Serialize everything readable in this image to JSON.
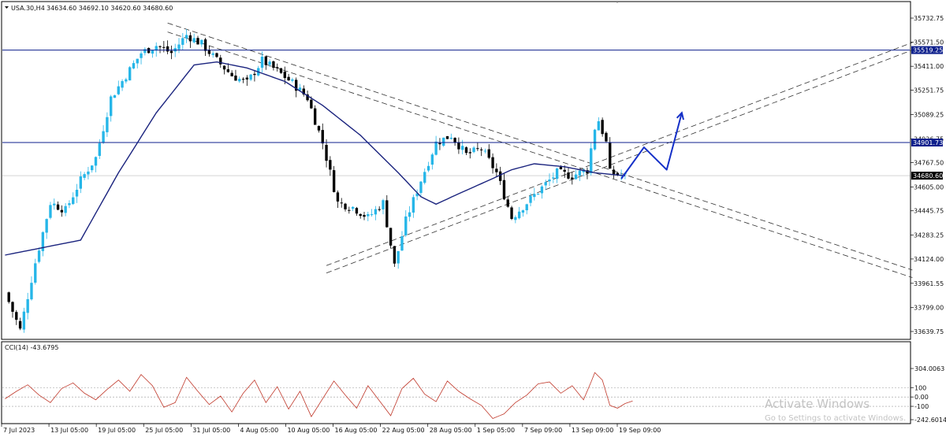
{
  "header": {
    "symbol": "USA.30,H4",
    "ohlc": "34634.60 34692.10 34620.60 34680.60"
  },
  "indicator": {
    "label": "CCI(14) -43.6795",
    "levels": [
      "304.0063",
      "100",
      "0.00",
      "-100",
      "-242.6014"
    ]
  },
  "watermark": {
    "title": "Activate Windows",
    "subtitle": "Go to Settings to activate Windows."
  },
  "colors": {
    "bull": "#26b6e8",
    "bear": "#000000",
    "ma": "#1a237e",
    "hline": "#0d1f8c",
    "cci": "#c0392b",
    "arrow": "#1530c8"
  },
  "chart_data": [
    {
      "type": "candlestick",
      "symbol": "USA.30",
      "timeframe": "H4",
      "y_ticks": [
        35732.75,
        35571.5,
        35411.0,
        35251.75,
        35089.25,
        34926.75,
        34767.5,
        34605.0,
        34445.75,
        34283.25,
        34124.0,
        33961.55,
        33799.0,
        33639.75
      ],
      "y_tick_labels": [
        "35732.75",
        "35571.50",
        "35411.00",
        "35251.75",
        "35089.25",
        "34926.75",
        "34767.50",
        "34605.00",
        "34445.75",
        "34283.25",
        "34124.00",
        "33961.55",
        "33799.00",
        "33639.75"
      ],
      "ylim": [
        33600,
        35800
      ],
      "x_tick_labels": [
        "7 Jul 2023",
        "13 Jul 05:00",
        "19 Jul 05:00",
        "25 Jul 05:00",
        "31 Jul 05:00",
        "4 Aug 05:00",
        "10 Aug 05:00",
        "16 Aug 05:00",
        "22 Aug 05:00",
        "28 Aug 05:00",
        "1 Sep 05:00",
        "7 Sep 09:00",
        "13 Sep 09:00",
        "19 Sep 09:00"
      ],
      "horizontal_levels": [
        {
          "value": 35519.25,
          "label": "35519.25"
        },
        {
          "value": 34901.73,
          "label": "34901.73"
        }
      ],
      "current_price": {
        "value": 34680.6,
        "label": "34680.60"
      },
      "close_path": [
        [
          0,
          33900
        ],
        [
          4,
          33650
        ],
        [
          8,
          34100
        ],
        [
          12,
          34500
        ],
        [
          16,
          34450
        ],
        [
          20,
          34650
        ],
        [
          24,
          34800
        ],
        [
          28,
          35200
        ],
        [
          32,
          35350
        ],
        [
          36,
          35500
        ],
        [
          40,
          35550
        ],
        [
          44,
          35500
        ],
        [
          48,
          35620
        ],
        [
          52,
          35560
        ],
        [
          56,
          35450
        ],
        [
          60,
          35350
        ],
        [
          64,
          35300
        ],
        [
          68,
          35450
        ],
        [
          72,
          35380
        ],
        [
          76,
          35300
        ],
        [
          80,
          35200
        ],
        [
          84,
          34900
        ],
        [
          88,
          34500
        ],
        [
          92,
          34470
        ],
        [
          96,
          34400
        ],
        [
          100,
          34500
        ],
        [
          103,
          34080
        ],
        [
          106,
          34380
        ],
        [
          110,
          34650
        ],
        [
          114,
          34900
        ],
        [
          118,
          34950
        ],
        [
          122,
          34820
        ],
        [
          126,
          34860
        ],
        [
          130,
          34700
        ],
        [
          134,
          34400
        ],
        [
          138,
          34500
        ],
        [
          142,
          34600
        ],
        [
          146,
          34700
        ],
        [
          150,
          34680
        ],
        [
          154,
          34720
        ],
        [
          156,
          35000
        ],
        [
          157,
          35050
        ],
        [
          159,
          34900
        ],
        [
          160,
          34700
        ],
        [
          164,
          34680
        ]
      ],
      "ma_path": [
        [
          0,
          34150
        ],
        [
          20,
          34250
        ],
        [
          30,
          34700
        ],
        [
          40,
          35100
        ],
        [
          50,
          35420
        ],
        [
          56,
          35440
        ],
        [
          64,
          35400
        ],
        [
          74,
          35310
        ],
        [
          84,
          35150
        ],
        [
          94,
          34950
        ],
        [
          104,
          34700
        ],
        [
          110,
          34540
        ],
        [
          114,
          34490
        ],
        [
          120,
          34560
        ],
        [
          128,
          34650
        ],
        [
          134,
          34720
        ],
        [
          140,
          34760
        ],
        [
          148,
          34740
        ],
        [
          156,
          34700
        ],
        [
          164,
          34680
        ]
      ],
      "x_domain": [
        0,
        240
      ]
    },
    {
      "type": "line",
      "name": "CCI(14)",
      "value": -43.6795,
      "y_ticks": [
        304.0063,
        100,
        0,
        -100,
        -242.6014
      ],
      "ylim": [
        -242.6014,
        304.0063
      ],
      "x_domain": [
        0,
        240
      ],
      "points": [
        [
          0,
          -20
        ],
        [
          3,
          60
        ],
        [
          6,
          130
        ],
        [
          9,
          20
        ],
        [
          12,
          -60
        ],
        [
          15,
          90
        ],
        [
          18,
          150
        ],
        [
          21,
          40
        ],
        [
          24,
          -30
        ],
        [
          27,
          80
        ],
        [
          30,
          180
        ],
        [
          33,
          60
        ],
        [
          36,
          240
        ],
        [
          39,
          120
        ],
        [
          42,
          -110
        ],
        [
          45,
          -60
        ],
        [
          48,
          210
        ],
        [
          51,
          60
        ],
        [
          54,
          -80
        ],
        [
          57,
          10
        ],
        [
          60,
          -160
        ],
        [
          63,
          40
        ],
        [
          66,
          180
        ],
        [
          69,
          -60
        ],
        [
          72,
          110
        ],
        [
          75,
          -130
        ],
        [
          78,
          60
        ],
        [
          81,
          -210
        ],
        [
          84,
          -20
        ],
        [
          87,
          170
        ],
        [
          90,
          20
        ],
        [
          93,
          -120
        ],
        [
          96,
          120
        ],
        [
          99,
          -40
        ],
        [
          102,
          -200
        ],
        [
          105,
          90
        ],
        [
          108,
          200
        ],
        [
          111,
          30
        ],
        [
          114,
          -50
        ],
        [
          117,
          170
        ],
        [
          120,
          60
        ],
        [
          123,
          -20
        ],
        [
          126,
          -90
        ],
        [
          129,
          -230
        ],
        [
          132,
          -180
        ],
        [
          135,
          -60
        ],
        [
          138,
          20
        ],
        [
          141,
          140
        ],
        [
          144,
          160
        ],
        [
          147,
          40
        ],
        [
          150,
          120
        ],
        [
          153,
          -30
        ],
        [
          155,
          160
        ],
        [
          156,
          260
        ],
        [
          158,
          180
        ],
        [
          160,
          -90
        ],
        [
          162,
          -120
        ],
        [
          164,
          -70
        ],
        [
          166,
          -43.68
        ]
      ]
    }
  ],
  "annotations": {
    "trendlines": [
      {
        "from": [
          43,
          35700
        ],
        "to": [
          240,
          34050
        ]
      },
      {
        "from": [
          43,
          35640
        ],
        "to": [
          240,
          34000
        ]
      },
      {
        "from": [
          85,
          34080
        ],
        "to": [
          240,
          35570
        ]
      },
      {
        "from": [
          85,
          34030
        ],
        "to": [
          240,
          35520
        ]
      }
    ],
    "projection_arrow": [
      [
        163,
        34660
      ],
      [
        169,
        34870
      ],
      [
        175,
        34720
      ],
      [
        179,
        35100
      ]
    ]
  }
}
